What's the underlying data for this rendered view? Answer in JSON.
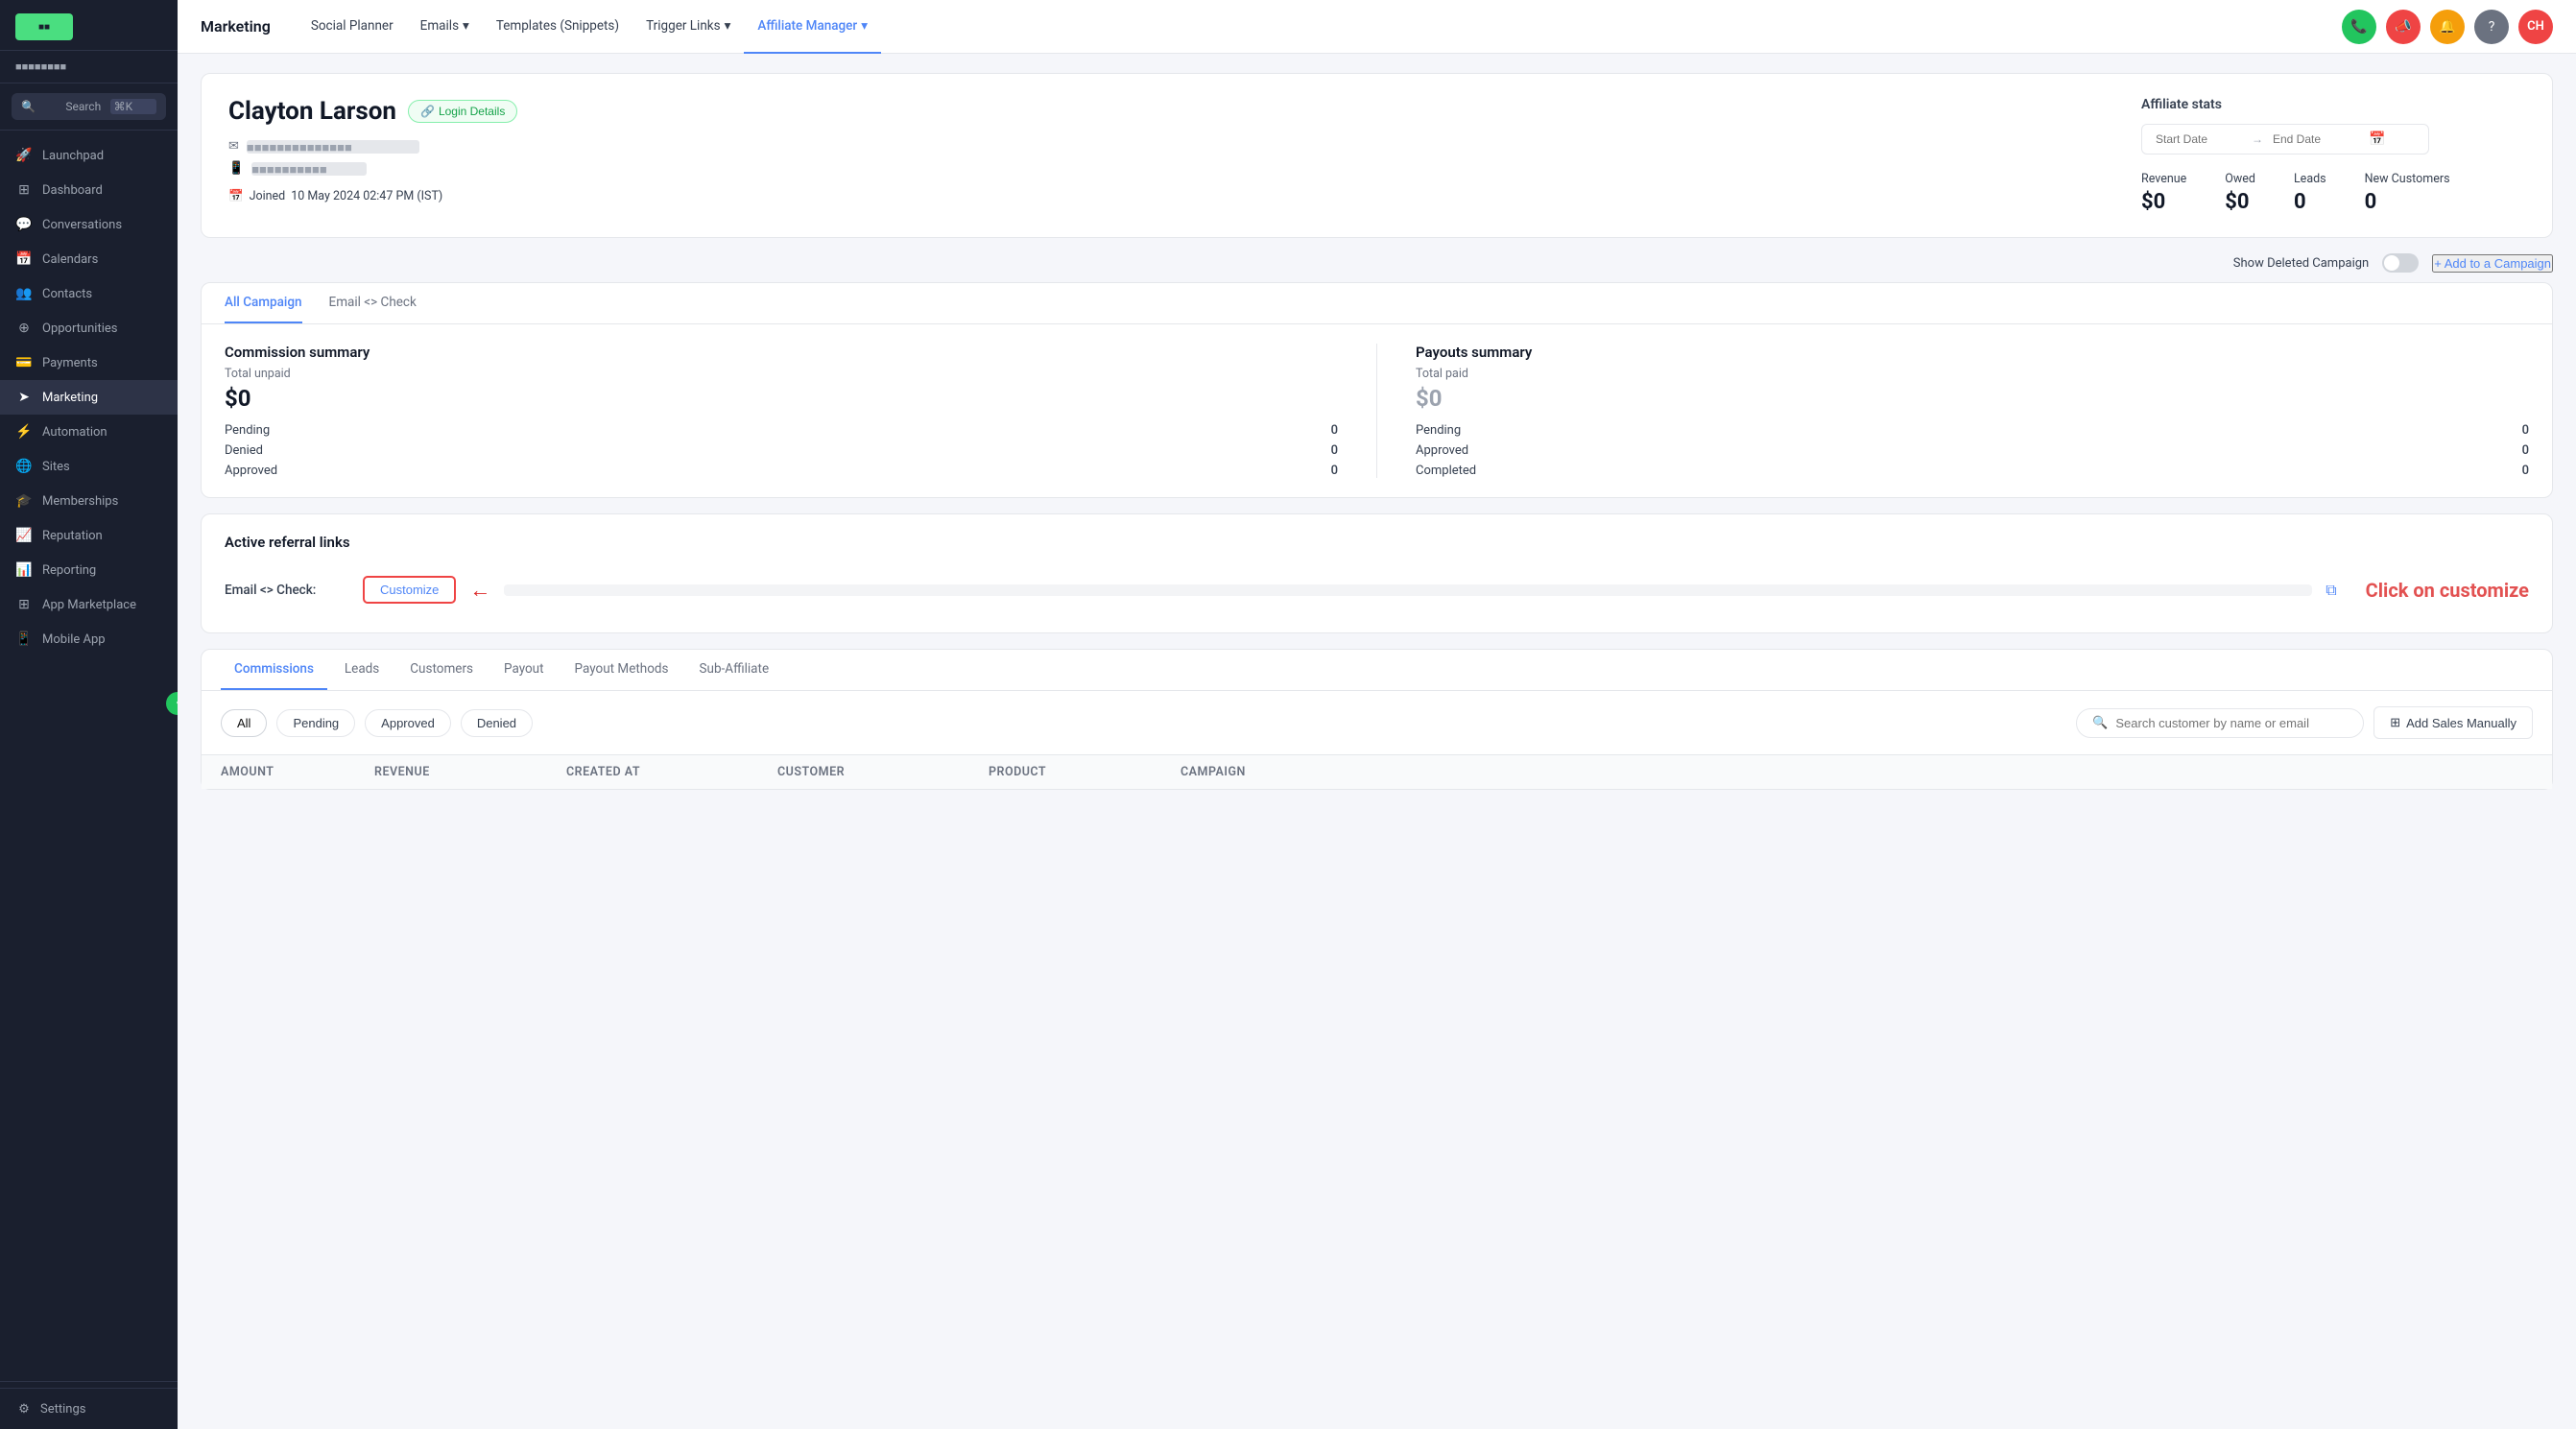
{
  "sidebar": {
    "logo_text": "■■",
    "account_name": "■■■■■■■■",
    "search_placeholder": "Search",
    "search_shortcut": "⌘K",
    "nav_items": [
      {
        "id": "launchpad",
        "label": "Launchpad",
        "icon": "🚀"
      },
      {
        "id": "dashboard",
        "label": "Dashboard",
        "icon": "⊞"
      },
      {
        "id": "conversations",
        "label": "Conversations",
        "icon": "💬"
      },
      {
        "id": "calendars",
        "label": "Calendars",
        "icon": "📅"
      },
      {
        "id": "contacts",
        "label": "Contacts",
        "icon": "👥"
      },
      {
        "id": "opportunities",
        "label": "Opportunities",
        "icon": "⊕"
      },
      {
        "id": "payments",
        "label": "Payments",
        "icon": "💳"
      },
      {
        "id": "marketing",
        "label": "Marketing",
        "icon": "➤"
      },
      {
        "id": "automation",
        "label": "Automation",
        "icon": "⚡"
      },
      {
        "id": "sites",
        "label": "Sites",
        "icon": "🌐"
      },
      {
        "id": "memberships",
        "label": "Memberships",
        "icon": "🎓"
      },
      {
        "id": "reputation",
        "label": "Reputation",
        "icon": "📈"
      },
      {
        "id": "reporting",
        "label": "Reporting",
        "icon": "📊"
      },
      {
        "id": "app-marketplace",
        "label": "App Marketplace",
        "icon": "⊞"
      },
      {
        "id": "mobile-app",
        "label": "Mobile App",
        "icon": "📱"
      }
    ],
    "settings_label": "Settings"
  },
  "topbar": {
    "section_title": "Marketing",
    "nav_items": [
      {
        "id": "social-planner",
        "label": "Social Planner",
        "active": false
      },
      {
        "id": "emails",
        "label": "Emails",
        "active": false,
        "has_dropdown": true
      },
      {
        "id": "templates",
        "label": "Templates (Snippets)",
        "active": false
      },
      {
        "id": "trigger-links",
        "label": "Trigger Links",
        "active": false,
        "has_dropdown": true
      },
      {
        "id": "affiliate-manager",
        "label": "Affiliate Manager",
        "active": true,
        "has_dropdown": true
      }
    ],
    "icons": [
      {
        "id": "phone",
        "symbol": "📞",
        "color": "ic-green"
      },
      {
        "id": "megaphone",
        "symbol": "📣",
        "color": "ic-red"
      },
      {
        "id": "bell",
        "symbol": "🔔",
        "color": "ic-orange"
      },
      {
        "id": "help",
        "symbol": "?",
        "color": "ic-gray"
      },
      {
        "id": "avatar",
        "symbol": "CH",
        "color": "ic-avatar"
      }
    ]
  },
  "profile": {
    "name": "Clayton Larson",
    "login_details_label": "Login Details",
    "email_masked": "■■■■■■■■■■■■■■",
    "phone_masked": "■■■■■■■■■■",
    "joined_label": "Joined",
    "joined_date": "10 May 2024 02:47 PM (IST)"
  },
  "affiliate_stats": {
    "title": "Affiliate stats",
    "start_date_placeholder": "Start Date",
    "end_date_placeholder": "End Date",
    "stats": [
      {
        "id": "revenue",
        "label": "Revenue",
        "value": "$0"
      },
      {
        "id": "owed",
        "label": "Owed",
        "value": "$0"
      },
      {
        "id": "leads",
        "label": "Leads",
        "value": "0"
      },
      {
        "id": "new-customers",
        "label": "New Customers",
        "value": "0"
      }
    ]
  },
  "campaign_controls": {
    "show_deleted_label": "Show Deleted Campaign",
    "add_campaign_label": "+ Add to a Campaign"
  },
  "summary": {
    "tabs": [
      {
        "id": "all-campaign",
        "label": "All Campaign",
        "active": true
      },
      {
        "id": "email-check",
        "label": "Email <> Check",
        "active": false
      }
    ],
    "commission": {
      "title": "Commission summary",
      "total_label": "Total unpaid",
      "total_value": "$0",
      "rows": [
        {
          "label": "Pending",
          "value": "0"
        },
        {
          "label": "Denied",
          "value": "0"
        },
        {
          "label": "Approved",
          "value": "0"
        }
      ]
    },
    "payouts": {
      "title": "Payouts summary",
      "total_label": "Total paid",
      "total_value": "$0",
      "rows": [
        {
          "label": "Pending",
          "value": "0"
        },
        {
          "label": "Approved",
          "value": "0"
        },
        {
          "label": "Completed",
          "value": "0"
        }
      ]
    }
  },
  "referral": {
    "title": "Active referral links",
    "campaign_label": "Email <> Check:",
    "customize_label": "Customize",
    "click_instruction": "Click on customize"
  },
  "commissions": {
    "section_tabs": [
      {
        "id": "commissions",
        "label": "Commissions",
        "active": true
      },
      {
        "id": "leads",
        "label": "Leads",
        "active": false
      },
      {
        "id": "customers",
        "label": "Customers",
        "active": false
      },
      {
        "id": "payout",
        "label": "Payout",
        "active": false
      },
      {
        "id": "payout-methods",
        "label": "Payout Methods",
        "active": false
      },
      {
        "id": "sub-affiliate",
        "label": "Sub-Affiliate",
        "active": false
      }
    ],
    "filters": [
      {
        "id": "all",
        "label": "All",
        "active": true
      },
      {
        "id": "pending",
        "label": "Pending",
        "active": false
      },
      {
        "id": "approved",
        "label": "Approved",
        "active": false
      },
      {
        "id": "denied",
        "label": "Denied",
        "active": false
      }
    ],
    "search_placeholder": "Search customer by name or email",
    "add_sales_label": "Add Sales Manually",
    "table_columns": [
      {
        "id": "amount",
        "label": "Amount"
      },
      {
        "id": "revenue",
        "label": "Revenue"
      },
      {
        "id": "created-at",
        "label": "Created At"
      },
      {
        "id": "customer",
        "label": "Customer"
      },
      {
        "id": "product",
        "label": "Product"
      },
      {
        "id": "campaign",
        "label": "Campaign"
      }
    ]
  }
}
